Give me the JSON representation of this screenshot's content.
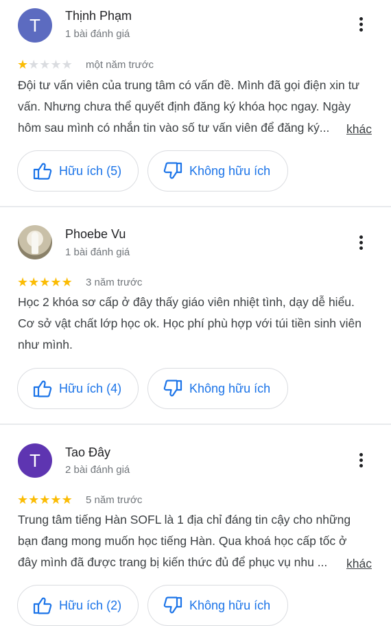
{
  "reviews": [
    {
      "author": "Thịnh Phạm",
      "avatar_letter": "T",
      "avatar_color": "#5c6bc0",
      "review_count": "1 bài đánh giá",
      "rating": 1,
      "time": "một năm trước",
      "lines": [
        "Đội tư vấn viên của trung tâm có vấn đề. Mình đã gọi điện xin tư",
        "vấn. Nhưng chưa thể quyết định đăng ký khóa học ngay. Ngày",
        "hôm sau mình có nhắn tin vào số tư vấn viên để đăng ký..."
      ],
      "more": "khác",
      "helpful": "Hữu ích (5)",
      "not_helpful": "Không hữu ích"
    },
    {
      "author": "Phoebe Vu",
      "review_count": "1 bài đánh giá",
      "rating": 5,
      "time": "3 năm trước",
      "lines": [
        "Học 2 khóa sơ cấp ở đây thấy giáo viên nhiệt tình, dạy dễ hiểu.",
        "Cơ sở vật chất lớp học ok. Học phí phù hợp với túi tiền sinh viên",
        "như mình."
      ],
      "helpful": "Hữu ích (4)",
      "not_helpful": "Không hữu ích"
    },
    {
      "author": "Tao Đây",
      "avatar_letter": "T",
      "avatar_color": "#5e35b1",
      "review_count": "2 bài đánh giá",
      "rating": 5,
      "time": "5 năm trước",
      "lines": [
        "Trung tâm tiếng Hàn SOFL là 1 địa chỉ đáng tin cậy cho những",
        "bạn đang mong muốn học tiếng Hàn. Qua khoá học cấp tốc ở",
        "đây mình đã được trang bị kiến thức đủ để phục vụ nhu ..."
      ],
      "more": "khác",
      "helpful": "Hữu ích (2)",
      "not_helpful": "Không hữu ích"
    }
  ],
  "colors": {
    "star_on": "#fbbc04",
    "star_off": "#dadce0",
    "accent": "#1a73e8"
  },
  "icons": {
    "menu": "more-vert-icon",
    "helpful": "thumb-up-icon",
    "not_helpful": "thumb-down-icon"
  }
}
